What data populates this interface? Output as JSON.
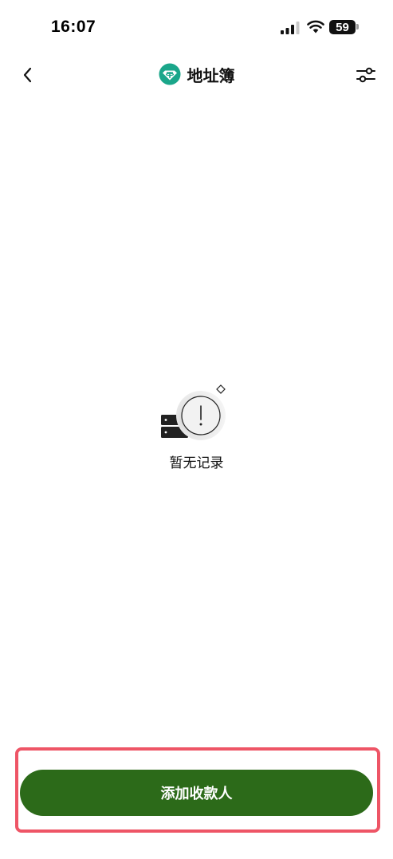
{
  "status_bar": {
    "time": "16:07",
    "battery_level": "59"
  },
  "header": {
    "title": "地址簿",
    "back_icon": "chevron-left-icon",
    "coin_icon": "tether-icon",
    "filter_icon": "sliders-icon"
  },
  "empty_state": {
    "illustration_icon": "empty-record-icon",
    "message": "暂无记录"
  },
  "footer": {
    "add_button_label": "添加收款人"
  },
  "colors": {
    "accent_green": "#2c6a19",
    "coin_teal": "#1aa68a",
    "highlight_red": "#ee5566"
  }
}
